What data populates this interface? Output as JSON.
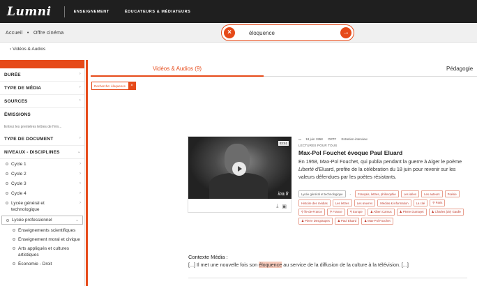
{
  "header": {
    "logo": "Lumni",
    "nav": [
      {
        "label": "Enseignement"
      },
      {
        "label": "Éducateurs & médiateurs"
      }
    ]
  },
  "breadcrumb": {
    "home": "Accueil",
    "sep": "•",
    "current": "Offre cinéma",
    "sub": "› Vidéos & Audios"
  },
  "search": {
    "query": "éloquence",
    "clear_icon": "×",
    "go_icon": "→"
  },
  "sidebar": {
    "filters_top": [
      {
        "label": "Durée"
      },
      {
        "label": "Type de média"
      },
      {
        "label": "Sources"
      }
    ],
    "emissions_label": "Émissions",
    "emissions_placeholder": "Entrez les premières lettres de l'ém...",
    "filters_mid": [
      {
        "label": "Type de document"
      },
      {
        "label": "Niveaux - Disciplines"
      }
    ],
    "levels": [
      {
        "label": "Cycle 1"
      },
      {
        "label": "Cycle 2"
      },
      {
        "label": "Cycle 3"
      },
      {
        "label": "Cycle 4"
      }
    ],
    "level_lycee_gt": "Lycée général et technologique",
    "level_lycee_pro": "Lycée professionnel",
    "sub_items": [
      {
        "label": "Enseignements scientifiques"
      },
      {
        "label": "Enseignement moral et civique"
      },
      {
        "label": "Arts appliqués et cultures artistiques"
      },
      {
        "label": "Économie - Droit"
      }
    ]
  },
  "tabs": {
    "active": "Vidéos & Audios (9)",
    "other": "Pédagogie"
  },
  "chip": {
    "label": "Recherche: éloquence",
    "close": "×"
  },
  "result": {
    "duration": "03:51",
    "watermark": "ina.fr",
    "date": "18 juin 1958",
    "source": "ORTF",
    "format": "Entretien-interview",
    "genre": "LECTURES POUR TOUS",
    "title": "Max-Pol Fouchet évoque Paul Eluard",
    "desc_1": "En 1958, Max-Pol Fouchet, qui publia pendant la guerre à Alger le poème ",
    "desc_em": "Liberté",
    "desc_2": " d'Eluard, profite de la célébration du 18 juin pour revenir sur les valeurs défendues par les poètes résistants.",
    "tags": [
      {
        "label": "Lycée général et technologique",
        "kind": "plain"
      },
      {
        "label": "-",
        "kind": "dash"
      },
      {
        "label": "Français, lettres, philosophie",
        "kind": "tag"
      },
      {
        "label": "Les idées",
        "kind": "tag"
      },
      {
        "label": "Les auteurs",
        "kind": "tag"
      },
      {
        "label": "Poésie",
        "kind": "tag"
      },
      {
        "label": "Histoire des médias",
        "kind": "tag"
      },
      {
        "label": "Les lettres",
        "kind": "tag"
      },
      {
        "label": "Les œuvres",
        "kind": "tag"
      },
      {
        "label": "Médias & information",
        "kind": "tag"
      },
      {
        "label": "La cité",
        "kind": "tag"
      },
      {
        "label": "⚲ Paris",
        "kind": "tag"
      },
      {
        "label": "⚲ Île-de-France",
        "kind": "tag"
      },
      {
        "label": "⚲ France",
        "kind": "tag"
      },
      {
        "label": "⚲ Europe",
        "kind": "tag"
      },
      {
        "label": "♟ Albert Camus",
        "kind": "tag"
      },
      {
        "label": "♟ Pierre Dumayet",
        "kind": "tag"
      },
      {
        "label": "♟ Charles (de) Gaulle",
        "kind": "tag"
      },
      {
        "label": "♟ Pierre Desgraupes",
        "kind": "tag"
      },
      {
        "label": "♟ Paul Eluard",
        "kind": "tag"
      },
      {
        "label": "♟ Max-Pol Fouchet",
        "kind": "tag"
      }
    ],
    "context_title": "Contexte Média :",
    "context_pre": "[...] Il met une nouvelle fois son ",
    "context_hl": "éloquence",
    "context_post": " au service de la diffusion de la culture à la télévision. [...]"
  },
  "colors": {
    "accent": "#e64a19",
    "topbar": "#1f1f1f"
  }
}
